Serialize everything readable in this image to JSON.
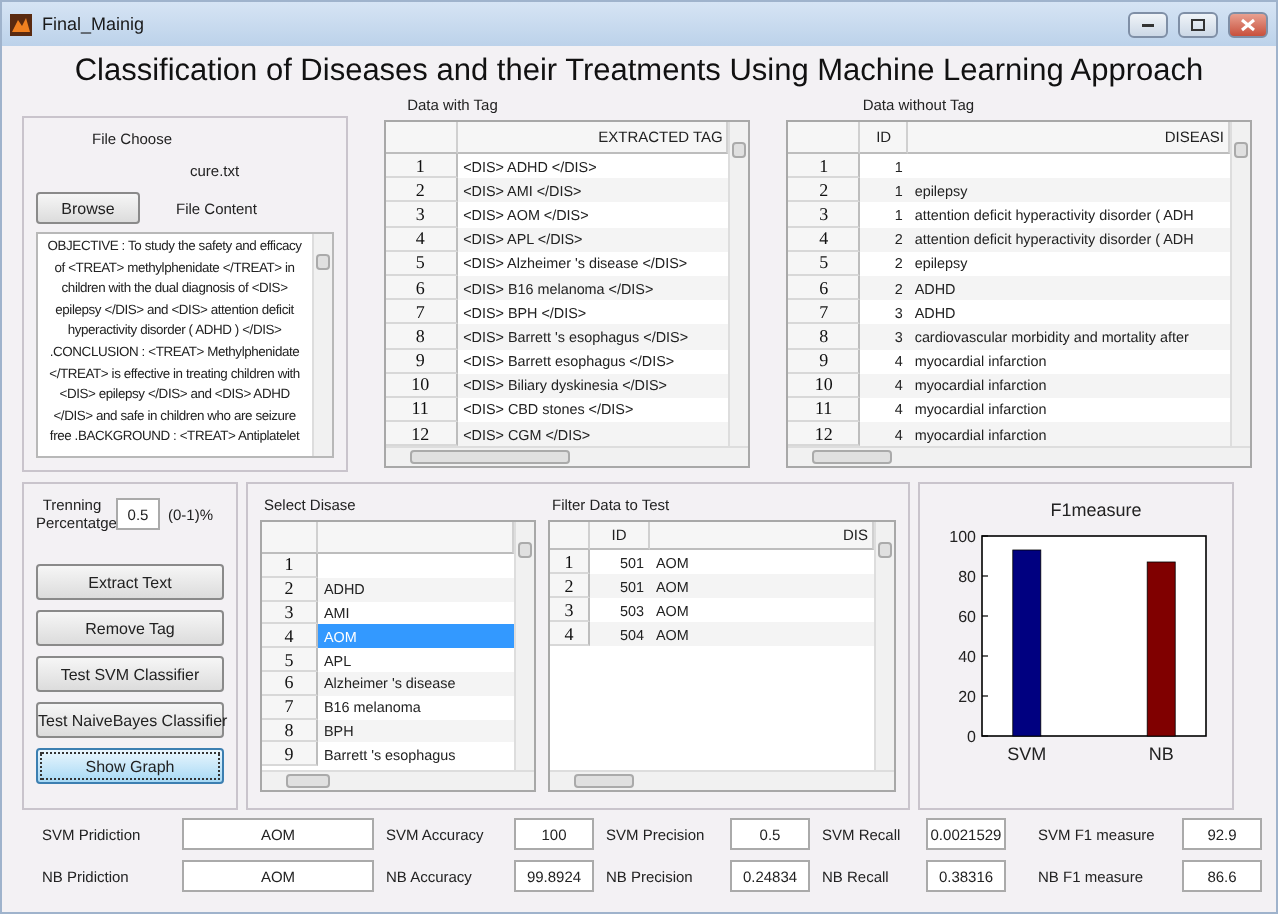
{
  "window": {
    "title": "Final_Mainig"
  },
  "heading": "Classification of Diseases and their Treatments Using Machine Learning Approach",
  "file_panel": {
    "label": "File Choose",
    "filename": "cure.txt",
    "browse_button": "Browse",
    "content_label": "File Content",
    "content": "OBJECTIVE : To study the safety and efficacy of <TREAT> methylphenidate </TREAT> in children with the dual diagnosis of <DIS> epilepsy </DIS> and <DIS> attention deficit hyperactivity disorder ( ADHD ) </DIS> .CONCLUSION : <TREAT> Methylphenidate </TREAT> is effective in treating children with <DIS> epilepsy </DIS> and <DIS> ADHD </DIS> and safe in children who are seizure free .BACKGROUND : <TREAT> Antiplatelet"
  },
  "tagged_table": {
    "caption": "Data with Tag",
    "columns": [
      "EXTRACTED TAG"
    ],
    "rows": [
      {
        "num": "1",
        "cells": [
          "<DIS> ADHD </DIS>"
        ]
      },
      {
        "num": "2",
        "cells": [
          "<DIS> AMI </DIS>"
        ]
      },
      {
        "num": "3",
        "cells": [
          "<DIS> AOM </DIS>"
        ]
      },
      {
        "num": "4",
        "cells": [
          "<DIS> APL </DIS>"
        ]
      },
      {
        "num": "5",
        "cells": [
          "<DIS> Alzheimer 's disease </DIS>"
        ]
      },
      {
        "num": "6",
        "cells": [
          "<DIS> B16 melanoma </DIS>"
        ]
      },
      {
        "num": "7",
        "cells": [
          "<DIS> BPH </DIS>"
        ]
      },
      {
        "num": "8",
        "cells": [
          "<DIS> Barrett 's esophagus </DIS>"
        ]
      },
      {
        "num": "9",
        "cells": [
          "<DIS> Barrett esophagus </DIS>"
        ]
      },
      {
        "num": "10",
        "cells": [
          "<DIS> Biliary dyskinesia </DIS>"
        ]
      },
      {
        "num": "11",
        "cells": [
          "<DIS> CBD stones </DIS>"
        ]
      },
      {
        "num": "12",
        "cells": [
          "<DIS> CGM </DIS>"
        ]
      }
    ]
  },
  "untagged_table": {
    "caption": "Data without Tag",
    "columns": [
      "ID",
      "DISEASI"
    ],
    "rows": [
      {
        "num": "1",
        "cells": [
          "1"
        ]
      },
      {
        "num": "2",
        "cells": [
          "1",
          "epilepsy"
        ]
      },
      {
        "num": "3",
        "cells": [
          "1",
          "attention deficit hyperactivity disorder ( ADH"
        ]
      },
      {
        "num": "4",
        "cells": [
          "2",
          "attention deficit hyperactivity disorder ( ADH"
        ]
      },
      {
        "num": "5",
        "cells": [
          "2",
          "epilepsy"
        ]
      },
      {
        "num": "6",
        "cells": [
          "2",
          "ADHD"
        ]
      },
      {
        "num": "7",
        "cells": [
          "3",
          "ADHD"
        ]
      },
      {
        "num": "8",
        "cells": [
          "3",
          "cardiovascular morbidity and mortality after"
        ]
      },
      {
        "num": "9",
        "cells": [
          "4",
          "myocardial infarction"
        ]
      },
      {
        "num": "10",
        "cells": [
          "4",
          "myocardial infarction"
        ]
      },
      {
        "num": "11",
        "cells": [
          "4",
          "myocardial infarction"
        ]
      },
      {
        "num": "12",
        "cells": [
          "4",
          "myocardial infarction"
        ]
      }
    ]
  },
  "training": {
    "label": "Trenning Percentatge",
    "value": "0.5",
    "hint": "(0-1)%"
  },
  "buttons": [
    {
      "label": "Extract Text",
      "focused": false
    },
    {
      "label": "Remove Tag",
      "focused": false
    },
    {
      "label": "Test SVM Classifier",
      "focused": false
    },
    {
      "label": "Test NaiveBayes Classifier",
      "focused": false
    },
    {
      "label": "Show Graph",
      "focused": true
    }
  ],
  "disease_list": {
    "caption": "Select Disase",
    "rows": [
      {
        "num": "1",
        "selected": false
      },
      {
        "num": "2",
        "name": "ADHD",
        "selected": false
      },
      {
        "num": "3",
        "name": "AMI",
        "selected": false
      },
      {
        "num": "4",
        "name": "AOM",
        "selected": true
      },
      {
        "num": "5",
        "name": "APL",
        "selected": false
      },
      {
        "num": "6",
        "name": "Alzheimer 's disease",
        "selected": false
      },
      {
        "num": "7",
        "name": "B16 melanoma",
        "selected": false
      },
      {
        "num": "8",
        "name": "BPH",
        "selected": false
      },
      {
        "num": "9",
        "name": "Barrett 's esophagus",
        "selected": false
      }
    ]
  },
  "filter_table": {
    "caption": "Filter Data to Test",
    "columns": [
      "ID",
      "DIS"
    ],
    "rows": [
      {
        "num": "1",
        "cells": [
          "501",
          "AOM"
        ]
      },
      {
        "num": "2",
        "cells": [
          "501",
          "AOM"
        ]
      },
      {
        "num": "3",
        "cells": [
          "503",
          "AOM"
        ]
      },
      {
        "num": "4",
        "cells": [
          "504",
          "AOM"
        ]
      }
    ]
  },
  "chart": {
    "chart_data": {
      "type": "bar",
      "title": "F1measure",
      "categories": [
        "SVM",
        "NB"
      ],
      "values": [
        93,
        87
      ],
      "ylim": [
        0,
        100
      ],
      "yticks": [
        0,
        20,
        40,
        60,
        80,
        100
      ]
    }
  },
  "metrics": [
    [
      {
        "label": "SVM Pridiction",
        "value": "AOM"
      },
      {
        "label": "SVM Accuracy",
        "value": "100"
      },
      {
        "label": "SVM Precision",
        "value": "0.5"
      },
      {
        "label": "SVM Recall",
        "value": "0.0021529"
      },
      {
        "label": "SVM F1 measure",
        "value": "92.9"
      }
    ],
    [
      {
        "label": "NB Pridiction",
        "value": "AOM"
      },
      {
        "label": "NB Accuracy",
        "value": "99.8924"
      },
      {
        "label": "NB Precision",
        "value": "0.24834"
      },
      {
        "label": "NB Recall",
        "value": "0.38316"
      },
      {
        "label": "NB F1 measure",
        "value": "86.6"
      }
    ]
  ]
}
